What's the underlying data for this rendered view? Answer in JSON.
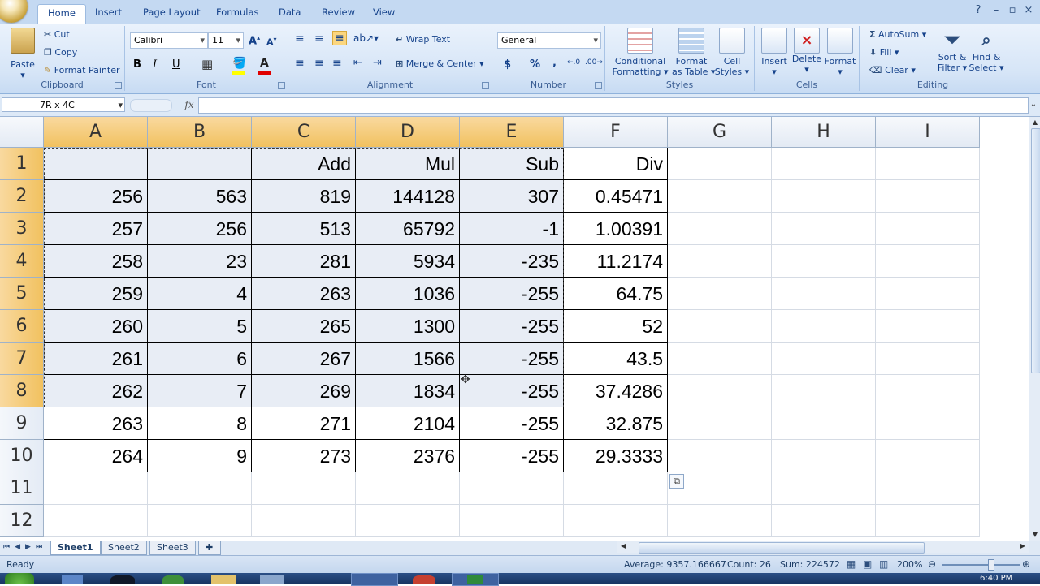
{
  "tabs": [
    "Home",
    "Insert",
    "Page Layout",
    "Formulas",
    "Data",
    "Review",
    "View"
  ],
  "clipboard": {
    "paste": "Paste",
    "cut": "Cut",
    "copy": "Copy",
    "format_painter": "Format Painter",
    "label": "Clipboard"
  },
  "font": {
    "name": "Calibri",
    "size": "11",
    "bold": "B",
    "italic": "I",
    "underline": "U",
    "label": "Font"
  },
  "alignment": {
    "wrap_text": "Wrap Text",
    "merge_center": "Merge & Center",
    "label": "Alignment"
  },
  "number": {
    "format": "General",
    "currency": "$",
    "percent": "%",
    "comma": ",",
    "label": "Number"
  },
  "styles": {
    "conditional": "Conditional",
    "formatting": "Formatting",
    "format_as": "Format",
    "as_table": "as Table",
    "cell": "Cell",
    "cell_styles": "Styles",
    "label": "Styles"
  },
  "cells": {
    "insert": "Insert",
    "delete": "Delete",
    "format": "Format",
    "label": "Cells"
  },
  "editing": {
    "autosum": "AutoSum",
    "fill": "Fill",
    "clear": "Clear",
    "sort": "Sort &",
    "filter": "Filter",
    "find": "Find &",
    "select": "Select",
    "label": "Editing"
  },
  "formula_bar": {
    "name_box": "7R x 4C",
    "fx": "fx"
  },
  "columns": [
    "A",
    "B",
    "C",
    "D",
    "E",
    "F",
    "G",
    "H",
    "I"
  ],
  "rows": [
    [
      "",
      "",
      "Add",
      "Mul",
      "Sub",
      "Div"
    ],
    [
      "256",
      "563",
      "819",
      "144128",
      "307",
      "0.45471"
    ],
    [
      "257",
      "256",
      "513",
      "65792",
      "-1",
      "1.00391"
    ],
    [
      "258",
      "23",
      "281",
      "5934",
      "-235",
      "11.2174"
    ],
    [
      "259",
      "4",
      "263",
      "1036",
      "-255",
      "64.75"
    ],
    [
      "260",
      "5",
      "265",
      "1300",
      "-255",
      "52"
    ],
    [
      "261",
      "6",
      "267",
      "1566",
      "-255",
      "43.5"
    ],
    [
      "262",
      "7",
      "269",
      "1834",
      "-255",
      "37.4286"
    ],
    [
      "263",
      "8",
      "271",
      "2104",
      "-255",
      "32.875"
    ],
    [
      "264",
      "9",
      "273",
      "2376",
      "-255",
      "29.3333"
    ],
    [
      "",
      "",
      "",
      "",
      "",
      ""
    ],
    [
      "",
      "",
      "",
      "",
      "",
      ""
    ]
  ],
  "row_numbers": [
    "1",
    "2",
    "3",
    "4",
    "5",
    "6",
    "7",
    "8",
    "9",
    "10",
    "11",
    "12"
  ],
  "sheets": [
    "Sheet1",
    "Sheet2",
    "Sheet3"
  ],
  "status": {
    "ready": "Ready",
    "average": "Average: 9357.166667",
    "count": "Count: 26",
    "sum": "Sum: 224572",
    "zoom": "200%"
  },
  "clock": "6:40 PM"
}
